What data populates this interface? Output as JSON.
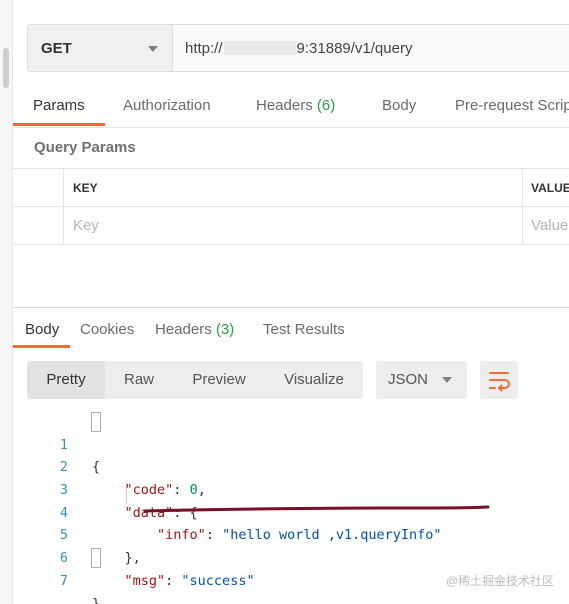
{
  "request": {
    "method": "GET",
    "url_prefix": "http://",
    "url_suffix": "9:31889/v1/query"
  },
  "request_tabs": [
    {
      "label": "Params"
    },
    {
      "label": "Authorization"
    },
    {
      "label": "Headers",
      "count": "(6)"
    },
    {
      "label": "Body"
    },
    {
      "label": "Pre-request Scrip"
    }
  ],
  "query_params": {
    "title": "Query Params",
    "col_key": "KEY",
    "col_value": "VALUE",
    "key_placeholder": "Key",
    "value_placeholder": "Value"
  },
  "response_tabs": [
    {
      "label": "Body"
    },
    {
      "label": "Cookies"
    },
    {
      "label": "Headers",
      "count": "(3)"
    },
    {
      "label": "Test Results"
    }
  ],
  "view_modes": [
    "Pretty",
    "Raw",
    "Preview",
    "Visualize"
  ],
  "format": "JSON",
  "code": {
    "line_numbers": [
      "1",
      "2",
      "3",
      "4",
      "5",
      "6",
      "7"
    ],
    "open_brace": "{",
    "code_key": "\"code\"",
    "code_val": "0",
    "data_key": "\"data\"",
    "info_key": "\"info\"",
    "info_val": "\"hello world ,v1.queryInfo\"",
    "data_close": "},",
    "msg_key": "\"msg\"",
    "msg_val": "\"success\"",
    "close_brace": "}"
  },
  "colors": {
    "accent": "#f26b3a",
    "count": "#2c9e42",
    "annotation_line": "#7a0f25"
  },
  "watermark": "@稀土掘金技术社区"
}
